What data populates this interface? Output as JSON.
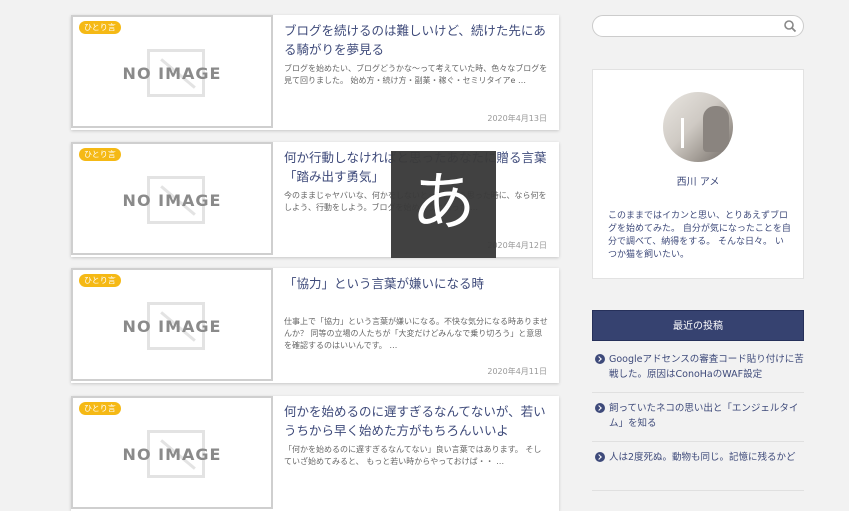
{
  "posts": [
    {
      "category": "ひとり言",
      "noimage": "NO IMAGE",
      "title": "ブログを続けるのは難しいけど、続けた先にある騎がりを夢見る",
      "excerpt": "ブログを始めたい、ブログどうかな～って考えていた時、色々なブログを見て回りました。 始め方・続け方・副業・稼ぐ・セミリタイアe …",
      "date": "2020年4月13日"
    },
    {
      "category": "ひとり言",
      "noimage": "NO IMAGE",
      "title": "何か行動しなければと思ったあなたに贈る言葉「踏み出す勇気」",
      "excerpt": "今のままじゃヤバいな、何かをしないとって、そう思った時に、なら何をしよう、行動をしよう。ブログを始めようと思った …",
      "date": "2020年4月12日"
    },
    {
      "category": "ひとり言",
      "noimage": "NO IMAGE",
      "title": "「協力」という言葉が嫌いになる時",
      "excerpt": "仕事上で「協力」という言葉が嫌いになる。不快な気分になる時ありませんか？ 同等の立場の人たちが「大変だけどみんなで乗り切ろう」と意思を確認するのはいいんです。 …",
      "date": "2020年4月11日"
    },
    {
      "category": "ひとり言",
      "noimage": "NO IMAGE",
      "title": "何かを始めるのに遅すぎるなんてないが、若いうちから早く始めた方がもちろんいいよ",
      "excerpt": "「何かを始めるのに遅すぎるなんてない」良い言葉ではあります。 そしていざ始めてみると、 もっと若い時からやっておけば・・ …",
      "date": ""
    }
  ],
  "sidebar": {
    "search_placeholder": "",
    "profile_name": "西川 アメ",
    "profile_desc": "このままではイカンと思い、とりあえずブログを始めてみた。 自分が気になったことを自分で調べて、納得をする。 そんな日々。 いつか猫を飼いたい。",
    "recent_heading": "最近の投稿",
    "recent_posts": [
      "Googleアドセンスの審査コード貼り付けに苦戦した。原因はConoHaのWAF設定",
      "飼っていたネコの思い出と「エンジェルタイム」を知る",
      "人は2度死ぬ。動物も同じ。記憶に残るかど"
    ]
  },
  "ime_indicator": "あ"
}
